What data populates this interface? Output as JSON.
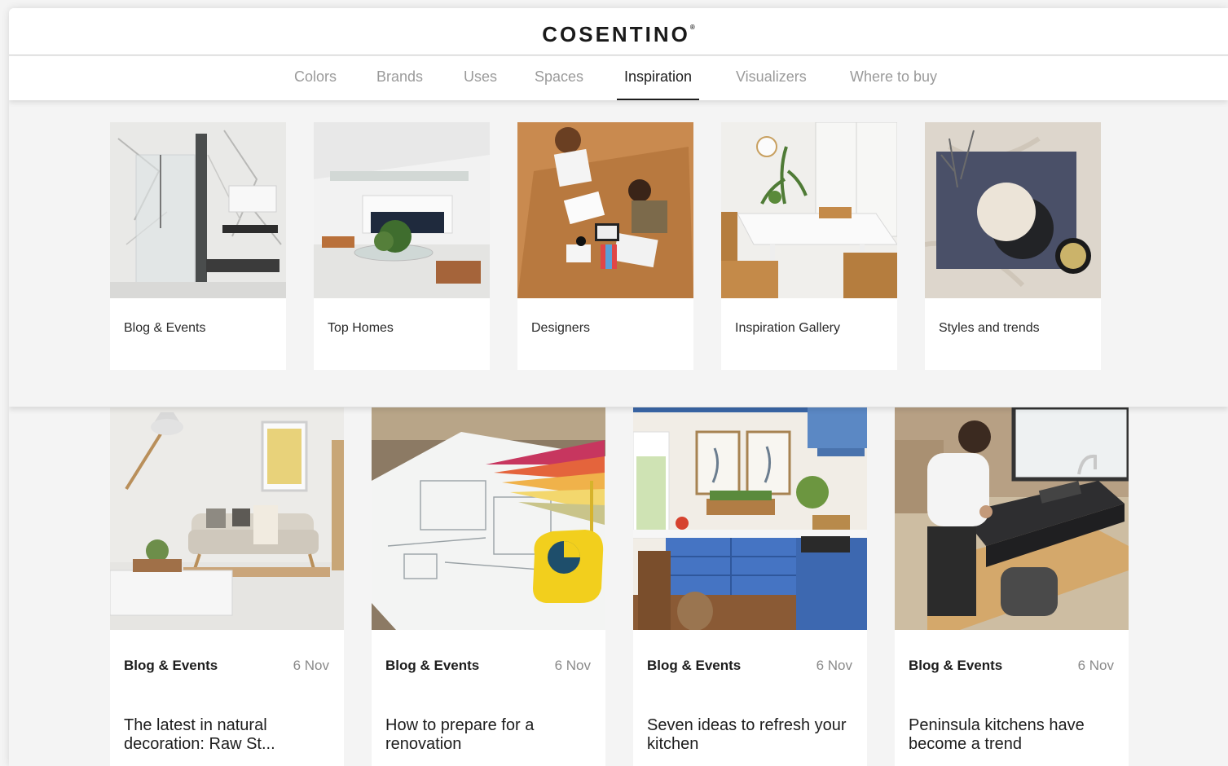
{
  "header": {
    "logo": "COSENTINO",
    "logo_mark": "®"
  },
  "nav": {
    "items": [
      {
        "label": "Colors"
      },
      {
        "label": "Brands"
      },
      {
        "label": "Uses"
      },
      {
        "label": "Spaces"
      },
      {
        "label": "Inspiration",
        "active": true
      },
      {
        "label": "Visualizers"
      },
      {
        "label": "Where to buy"
      }
    ]
  },
  "menu": {
    "tiles": [
      {
        "label": "Blog & Events"
      },
      {
        "label": "Top Homes"
      },
      {
        "label": "Designers"
      },
      {
        "label": "Inspiration Gallery"
      },
      {
        "label": "Styles and trends"
      }
    ]
  },
  "articles": [
    {
      "category": "Blog & Events",
      "date": "6 Nov",
      "title": "The latest in natural decoration: Raw St..."
    },
    {
      "category": "Blog & Events",
      "date": "6 Nov",
      "title": "How to prepare for a renovation"
    },
    {
      "category": "Blog & Events",
      "date": "6 Nov",
      "title": "Seven ideas to refresh your kitchen"
    },
    {
      "category": "Blog & Events",
      "date": "6 Nov",
      "title": "Peninsula kitchens have become a trend"
    }
  ]
}
